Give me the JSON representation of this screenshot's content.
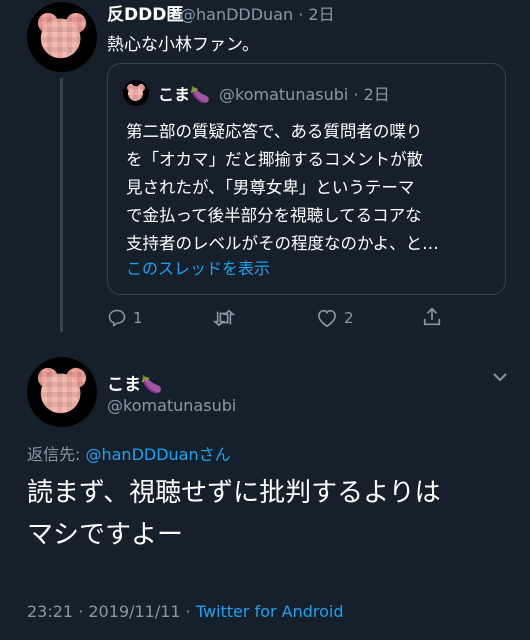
{
  "tweet1": {
    "display_name": "反DDD匿",
    "handle": "@hanDDDuan",
    "time": "2日",
    "text": "熱心な小林ファン。",
    "quoted": {
      "display_name": "こま🍆",
      "handle": "@komatunasubi",
      "time": "2日",
      "lines": [
        "第二部の質疑応答で、ある質問者の喋り",
        "を「オカマ」だと揶揄するコメントが散",
        "見されたが、「男尊女卑」というテーマ",
        "で金払って後半部分を視聴してるコアな",
        "支持者のレベルがその程度なのかよ、と…"
      ],
      "show_thread": "このスレッドを表示"
    },
    "actions": {
      "reply_count": "1",
      "retweet_count": "",
      "like_count": "2"
    }
  },
  "tweet2": {
    "display_name": "こま🍆",
    "handle": "@komatunasubi",
    "reply_prefix": "返信先: ",
    "reply_to": "@hanDDDuan",
    "reply_suffix": "さん",
    "text_line1": "読まず、視聴せずに批判するよりは",
    "text_line2": "マシですよー",
    "timestamp": "23:21 · 2019/11/11 · ",
    "source": "Twitter for Android"
  },
  "colors": {
    "background": "#15202b",
    "accent": "#1da1f2",
    "muted": "#8899a6",
    "border": "#38444d"
  }
}
